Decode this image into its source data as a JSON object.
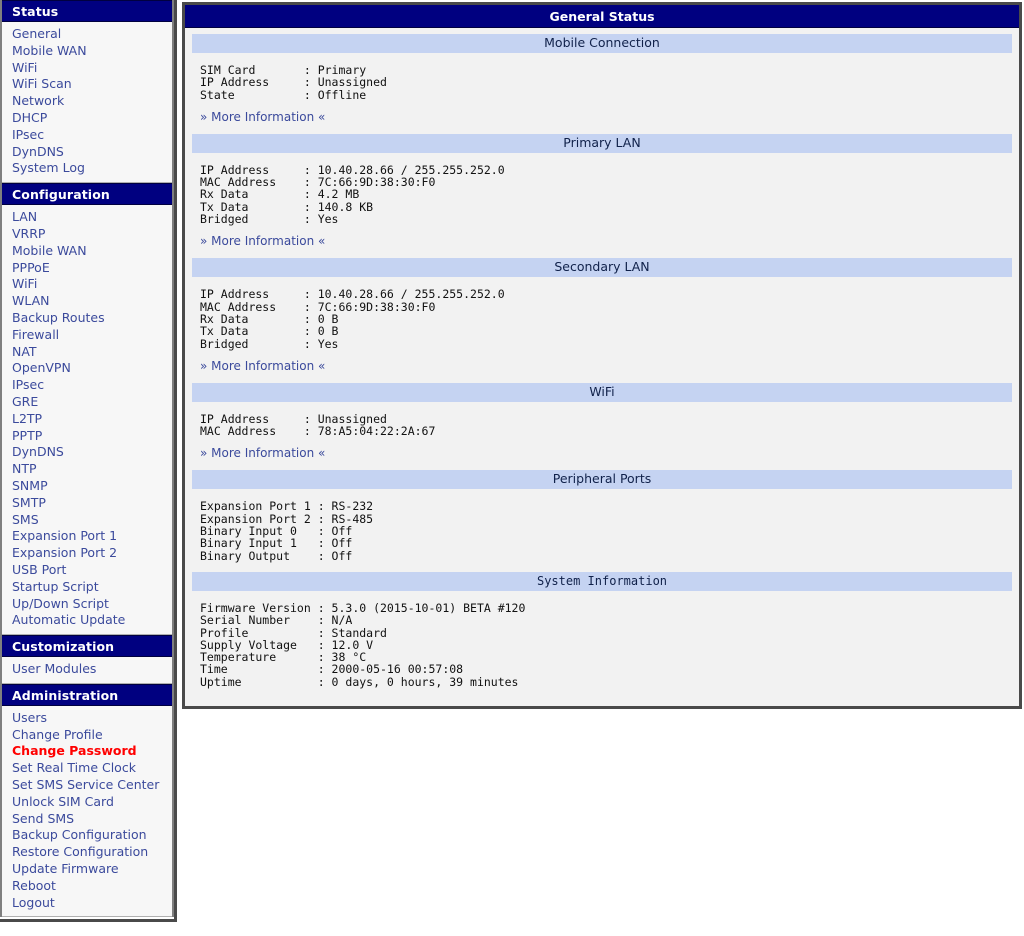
{
  "sidebar": {
    "groups": [
      {
        "title": "Status",
        "items": [
          {
            "label": "General",
            "active": false
          },
          {
            "label": "Mobile WAN",
            "active": false
          },
          {
            "label": "WiFi",
            "active": false
          },
          {
            "label": "WiFi Scan",
            "active": false
          },
          {
            "label": "Network",
            "active": false
          },
          {
            "label": "DHCP",
            "active": false
          },
          {
            "label": "IPsec",
            "active": false
          },
          {
            "label": "DynDNS",
            "active": false
          },
          {
            "label": "System Log",
            "active": false
          }
        ]
      },
      {
        "title": "Configuration",
        "items": [
          {
            "label": "LAN",
            "active": false
          },
          {
            "label": "VRRP",
            "active": false
          },
          {
            "label": "Mobile WAN",
            "active": false
          },
          {
            "label": "PPPoE",
            "active": false
          },
          {
            "label": "WiFi",
            "active": false
          },
          {
            "label": "WLAN",
            "active": false
          },
          {
            "label": "Backup Routes",
            "active": false
          },
          {
            "label": "Firewall",
            "active": false
          },
          {
            "label": "NAT",
            "active": false
          },
          {
            "label": "OpenVPN",
            "active": false
          },
          {
            "label": "IPsec",
            "active": false
          },
          {
            "label": "GRE",
            "active": false
          },
          {
            "label": "L2TP",
            "active": false
          },
          {
            "label": "PPTP",
            "active": false
          },
          {
            "label": "DynDNS",
            "active": false
          },
          {
            "label": "NTP",
            "active": false
          },
          {
            "label": "SNMP",
            "active": false
          },
          {
            "label": "SMTP",
            "active": false
          },
          {
            "label": "SMS",
            "active": false
          },
          {
            "label": "Expansion Port 1",
            "active": false
          },
          {
            "label": "Expansion Port 2",
            "active": false
          },
          {
            "label": "USB Port",
            "active": false
          },
          {
            "label": "Startup Script",
            "active": false
          },
          {
            "label": "Up/Down Script",
            "active": false
          },
          {
            "label": "Automatic Update",
            "active": false
          }
        ]
      },
      {
        "title": "Customization",
        "items": [
          {
            "label": "User Modules",
            "active": false
          }
        ]
      },
      {
        "title": "Administration",
        "items": [
          {
            "label": "Users",
            "active": false
          },
          {
            "label": "Change Profile",
            "active": false
          },
          {
            "label": "Change Password",
            "active": true
          },
          {
            "label": "Set Real Time Clock",
            "active": false
          },
          {
            "label": "Set SMS Service Center",
            "active": false
          },
          {
            "label": "Unlock SIM Card",
            "active": false
          },
          {
            "label": "Send SMS",
            "active": false
          },
          {
            "label": "Backup Configuration",
            "active": false
          },
          {
            "label": "Restore Configuration",
            "active": false
          },
          {
            "label": "Update Firmware",
            "active": false
          },
          {
            "label": "Reboot",
            "active": false
          },
          {
            "label": "Logout",
            "active": false
          }
        ]
      }
    ]
  },
  "main": {
    "title": "General Status",
    "more_information_label": "» More Information «",
    "sections": [
      {
        "title": "Mobile Connection",
        "rows": [
          "SIM Card       : Primary",
          "IP Address     : Unassigned",
          "State          : Offline"
        ],
        "has_more": true
      },
      {
        "title": "Primary LAN",
        "rows": [
          "IP Address     : 10.40.28.66 / 255.255.252.0",
          "MAC Address    : 7C:66:9D:38:30:F0",
          "Rx Data        : 4.2 MB",
          "Tx Data        : 140.8 KB",
          "Bridged        : Yes"
        ],
        "has_more": true
      },
      {
        "title": "Secondary LAN",
        "rows": [
          "IP Address     : 10.40.28.66 / 255.255.252.0",
          "MAC Address    : 7C:66:9D:38:30:F0",
          "Rx Data        : 0 B",
          "Tx Data        : 0 B",
          "Bridged        : Yes"
        ],
        "has_more": true
      },
      {
        "title": "WiFi",
        "rows": [
          "IP Address     : Unassigned",
          "MAC Address    : 78:A5:04:22:2A:67"
        ],
        "has_more": true
      },
      {
        "title": "Peripheral Ports",
        "rows": [
          "Expansion Port 1 : RS-232",
          "Expansion Port 2 : RS-485",
          "Binary Input 0   : Off",
          "Binary Input 1   : Off",
          "Binary Output    : Off"
        ],
        "has_more": false
      },
      {
        "title": "System Information",
        "mono_title": true,
        "rows": [
          "Firmware Version : 5.3.0 (2015-10-01) BETA #120",
          "Serial Number    : N/A",
          "Profile          : Standard",
          "Supply Voltage   : 12.0 V",
          "Temperature      : 38 °C",
          "Time             : 2000-05-16 00:57:08",
          "Uptime           : 0 days, 0 hours, 39 minutes"
        ],
        "has_more": false
      }
    ]
  },
  "colors": {
    "header_blue": "#000080",
    "section_blue": "#c5d3f2",
    "link_blue": "#3b4a9c",
    "active_red": "#ff0000",
    "panel_bg": "#f2f2f2"
  }
}
